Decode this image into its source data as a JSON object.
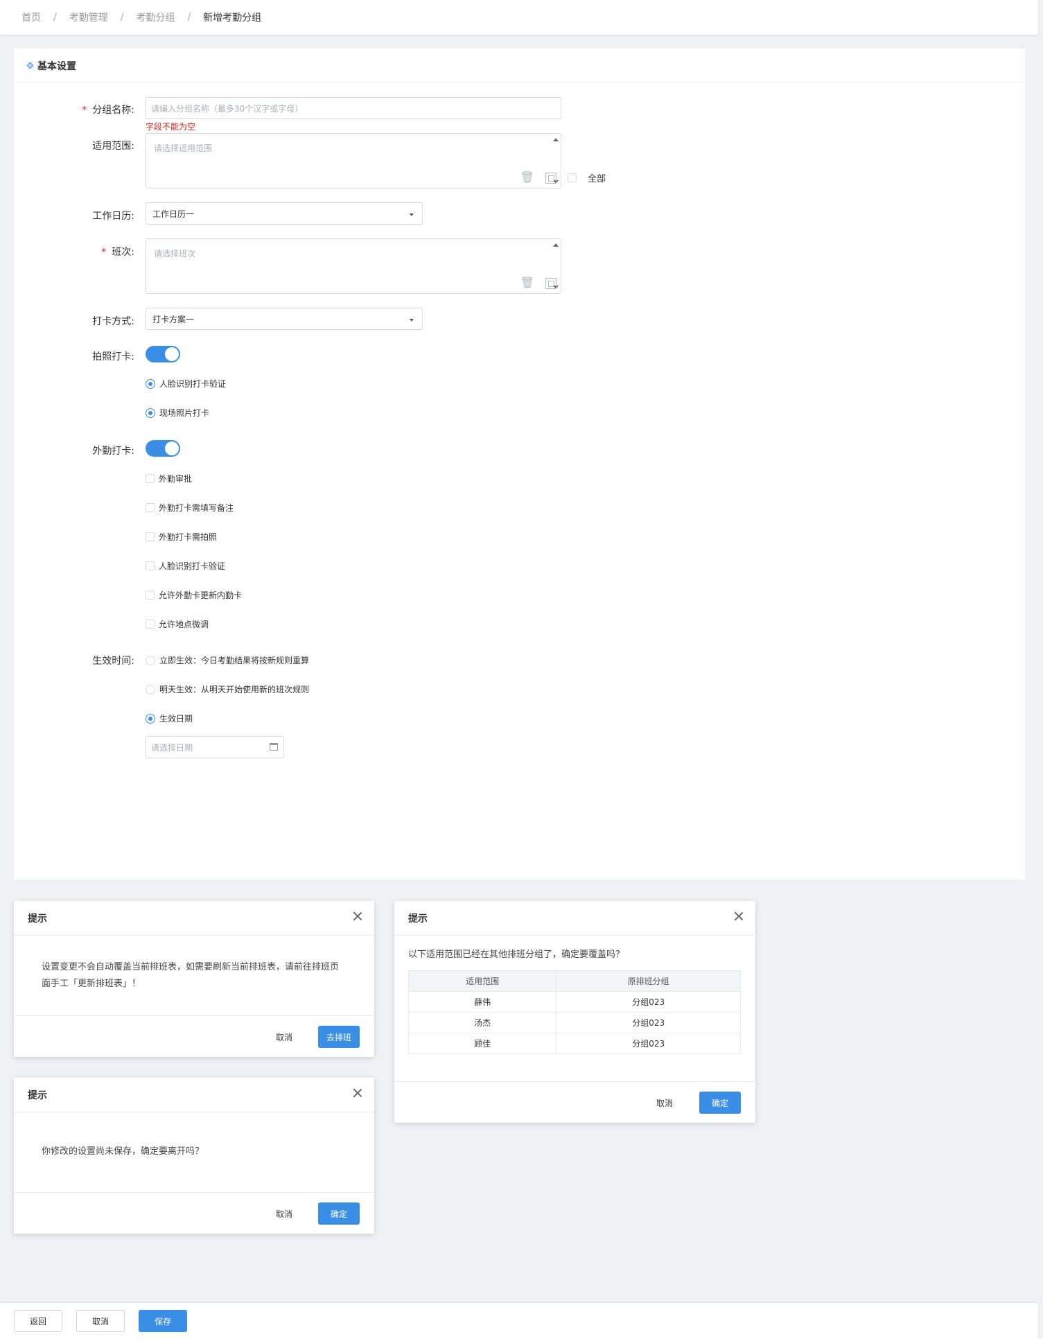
{
  "breadcrumb": [
    "首页",
    "考勤管理",
    "考勤分组",
    "新增考勤分组"
  ],
  "section_title": "基本设置",
  "form": {
    "group_name": {
      "label": "分组名称:",
      "placeholder": "请编入分组名称（最多30个汉字或字母）",
      "error": "字段不能为空"
    },
    "scope": {
      "label": "适用范围:",
      "placeholder": "请选择适用范围",
      "all_label": "全部"
    },
    "calendar": {
      "label": "工作日历:",
      "value": "工作日历一"
    },
    "shift": {
      "label": "班次:",
      "placeholder": "请选择班次"
    },
    "clock_method": {
      "label": "打卡方式:",
      "value": "打卡方案一"
    },
    "photo_clock": {
      "label": "拍照打卡:",
      "enabled": true,
      "options": [
        "人脸识别打卡验证",
        "现场照片打卡"
      ]
    },
    "field_clock": {
      "label": "外勤打卡:",
      "enabled": true,
      "options": [
        "外勤审批",
        "外勤打卡需填写备注",
        "外勤打卡需拍照",
        "人脸识别打卡验证",
        "允许外勤卡更新内勤卡",
        "允许地点微调"
      ]
    },
    "effective": {
      "label": "生效时间:",
      "options": [
        "立即生效：今日考勤结果将按新规则重算",
        "明天生效：从明天开始使用新的班次规则",
        "生效日期"
      ],
      "selected": 2,
      "date_placeholder": "请选择日期"
    }
  },
  "modal1": {
    "title": "提示",
    "body": "设置变更不会自动覆盖当前排班表，如需要刷新当前排班表，请前往排班页面手工「更新排班表」！",
    "cancel": "取消",
    "confirm": "去排班"
  },
  "modal2": {
    "title": "提示",
    "body": "你修改的设置尚未保存，确定要离开吗？",
    "cancel": "取消",
    "confirm": "确定"
  },
  "modal3": {
    "title": "提示",
    "body": "以下适用范围已经在其他排班分组了，确定要覆盖吗？",
    "table": {
      "headers": [
        "适用范围",
        "原排班分组"
      ],
      "rows": [
        [
          "薛伟",
          "分组023"
        ],
        [
          "汤杰",
          "分组023"
        ],
        [
          "顾佳",
          "分组023"
        ]
      ]
    },
    "cancel": "取消",
    "confirm": "确定"
  },
  "footer": {
    "back": "返回",
    "cancel": "取消",
    "save": "保存"
  },
  "colors": {
    "primary": "#3a8ee6",
    "error": "#e02020",
    "background": "#eff1f5"
  }
}
